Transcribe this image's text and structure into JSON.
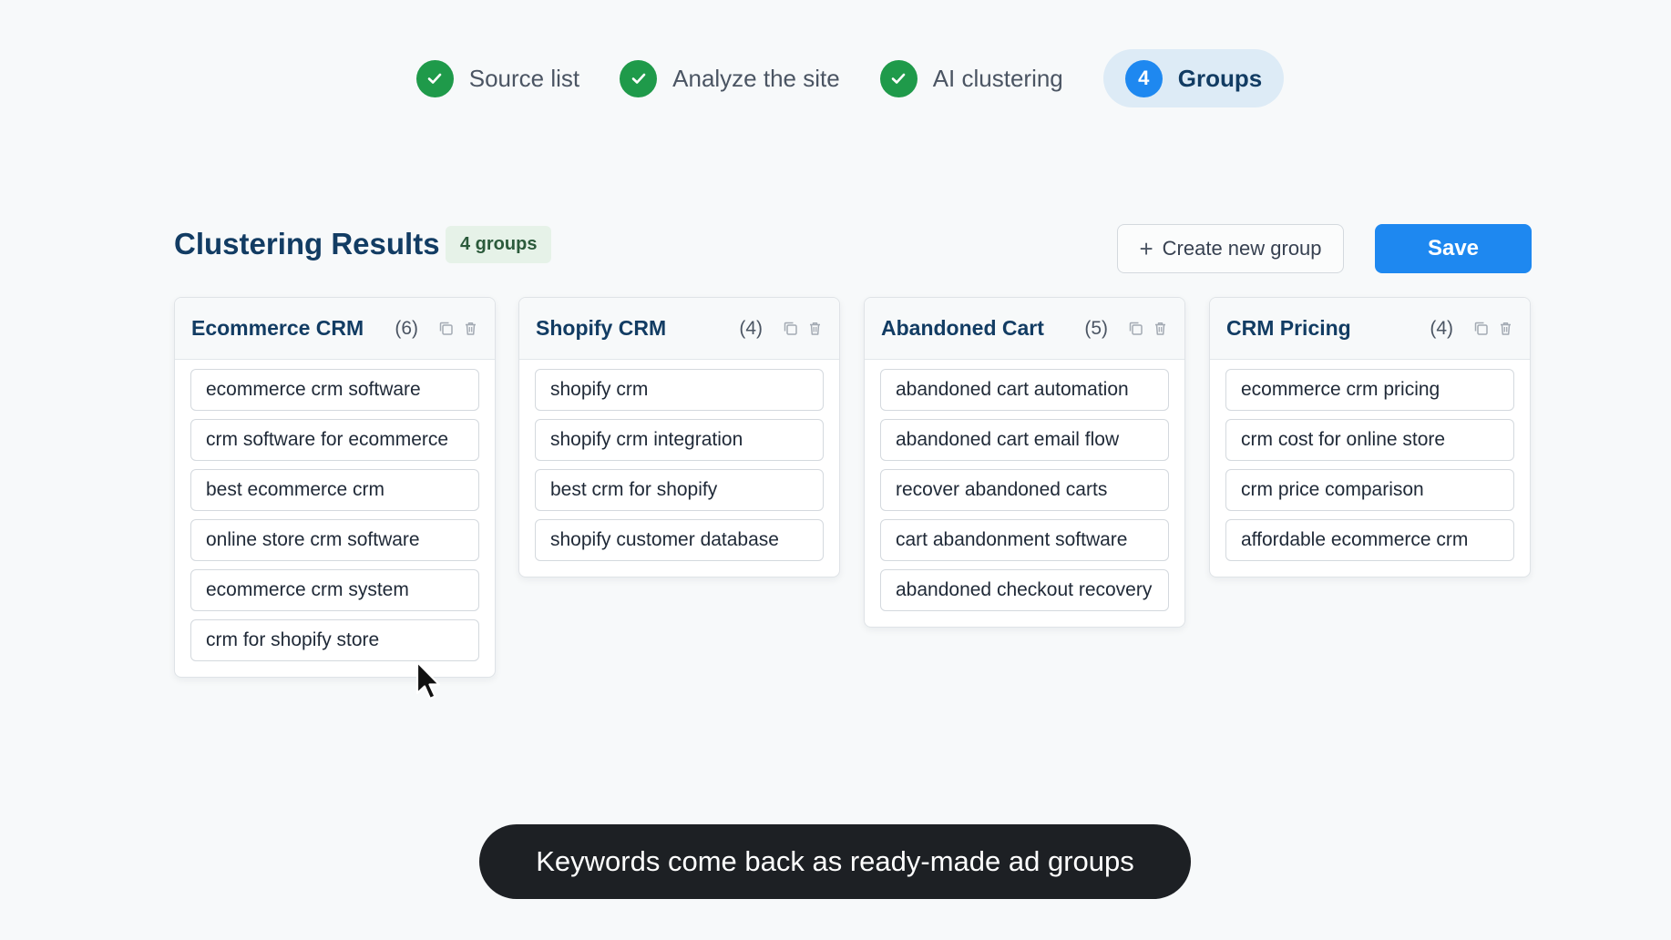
{
  "stepper": {
    "steps": [
      {
        "label": "Source list",
        "status": "done"
      },
      {
        "label": "Analyze the site",
        "status": "done"
      },
      {
        "label": "AI clustering",
        "status": "done"
      },
      {
        "label": "Groups",
        "number": "4",
        "status": "active"
      }
    ]
  },
  "header": {
    "title": "Clustering Results",
    "badge": "4 groups",
    "create_label": "Create new group",
    "save_label": "Save"
  },
  "groups": [
    {
      "title": "Ecommerce CRM",
      "count": "(6)",
      "keywords": [
        "ecommerce crm software",
        "crm software for ecommerce",
        "best ecommerce crm",
        "online store crm software",
        "ecommerce crm system",
        "crm for shopify store"
      ]
    },
    {
      "title": "Shopify CRM",
      "count": "(4)",
      "keywords": [
        "shopify crm",
        "shopify crm integration",
        "best crm for shopify",
        "shopify customer database"
      ]
    },
    {
      "title": "Abandoned Cart",
      "count": "(5)",
      "keywords": [
        "abandoned cart automation",
        "abandoned cart email flow",
        "recover abandoned carts",
        "cart abandonment software",
        "abandoned checkout recovery"
      ]
    },
    {
      "title": "CRM Pricing",
      "count": "(4)",
      "keywords": [
        "ecommerce crm pricing",
        "crm cost for online store",
        "crm price comparison",
        "affordable ecommerce crm"
      ]
    }
  ],
  "caption": "Keywords come back as ready-made ad groups",
  "colors": {
    "accent": "#1e88f0",
    "success": "#1f9a4a",
    "heading": "#123c63"
  }
}
